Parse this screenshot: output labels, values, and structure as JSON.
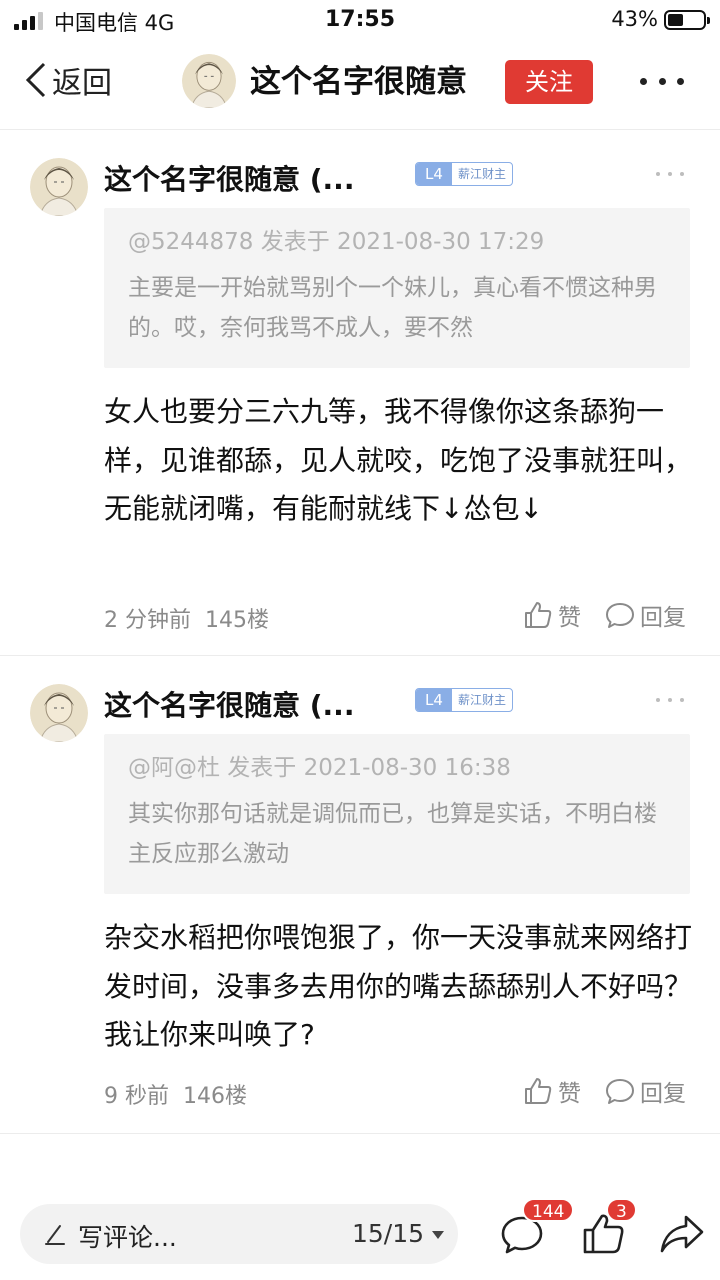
{
  "status_bar": {
    "carrier": "中国电信  4G",
    "time": "17:55",
    "battery": "43%",
    "battery_level": 0.43
  },
  "nav": {
    "back_label": "返回",
    "title": "这个名字很随意",
    "follow_label": "关注"
  },
  "posts": [
    {
      "author": "这个名字很随意 (...",
      "level": "L4",
      "badge_title": "薪江财主",
      "quote_header": "@5244878 发表于 2021-08-30 17:29",
      "quote_text": "主要是一开始就骂别个一个妹儿，真心看不惯这种男的。哎，奈何我骂不成人，要不然",
      "content": "女人也要分三六九等，我不得像你这条舔狗一样，见谁都舔，见人就咬，吃饱了没事就狂叫，无能就闭嘴，有能耐就线下↓怂包↓",
      "time": "2 分钟前",
      "floor": "145楼",
      "like_label": "赞",
      "reply_label": "回复"
    },
    {
      "author": "这个名字很随意 (...",
      "level": "L4",
      "badge_title": "薪江财主",
      "quote_header": "@阿@杜 发表于 2021-08-30 16:38",
      "quote_text": "其实你那句话就是调侃而已，也算是实话，不明白楼主反应那么激动",
      "content": "杂交水稻把你喂饱狠了，你一天没事就来网络打发时间，没事多去用你的嘴去舔舔别人不好吗？我让你来叫唤了?",
      "time": "9 秒前",
      "floor": "146楼",
      "like_label": "赞",
      "reply_label": "回复"
    }
  ],
  "bottom_bar": {
    "comment_placeholder": "写评论...",
    "page_indicator": "15/15",
    "comment_count": "144",
    "like_count": "3"
  },
  "colors": {
    "accent_red": "#e03a33",
    "level_badge": "#8aaee6",
    "quote_bg": "#f4f4f4",
    "meta_gray": "#8a8a8a"
  },
  "icons": [
    "signal-icon",
    "battery-icon",
    "back-chevron-icon",
    "more-icon",
    "avatar",
    "like-icon",
    "reply-icon",
    "pen-icon",
    "comment-icon",
    "thumbs-up-icon",
    "share-icon"
  ]
}
